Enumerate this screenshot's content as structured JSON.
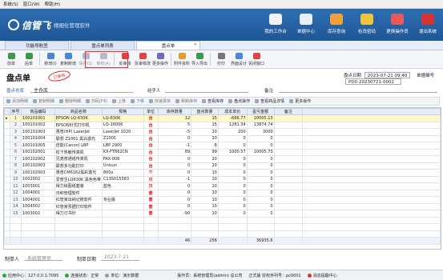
{
  "menubar": {
    "items": [
      "系统(S)",
      "窗口(W)",
      "帮助(H)"
    ]
  },
  "header": {
    "brand": "信管飞",
    "slogan": "精细化管理软件",
    "nav": [
      {
        "label": "我的工作台",
        "icon": "workbench-icon",
        "color": "#f3f3f3"
      },
      {
        "label": "单据中心",
        "icon": "document-center-icon",
        "color": "#e9eef9"
      },
      {
        "label": "库存查询",
        "icon": "inventory-icon",
        "color": "#f2a13a"
      },
      {
        "label": "检改密码",
        "icon": "password-lock-icon",
        "color": "#f1c43b"
      },
      {
        "label": "更换操作员",
        "icon": "switch-user-icon",
        "color": "#e85a5a"
      },
      {
        "label": "退出系统",
        "icon": "exit-icon",
        "color": "#d63333"
      }
    ]
  },
  "tabs": [
    "功能导航签",
    "盘点单列表",
    "盘点单"
  ],
  "toolbar": [
    {
      "label": "前单",
      "icon": "prev-icon",
      "color": "#3b9a4a",
      "enabled": true
    },
    {
      "label": "后单",
      "icon": "next-icon",
      "color": "#3b9a4a",
      "enabled": true
    },
    {
      "label": "新增(I)",
      "icon": "new-icon",
      "color": "#4a86d6",
      "enabled": true
    },
    {
      "label": "复制新增",
      "icon": "copy-icon",
      "color": "#4a86d6",
      "enabled": true
    },
    {
      "label": "保存(S)",
      "icon": "save-icon",
      "color": "#6d7fa0",
      "enabled": false
    },
    {
      "label": "审核(A)",
      "icon": "audit-icon",
      "color": "#6d7fa0",
      "enabled": false
    },
    {
      "label": "反审核",
      "icon": "unaudit-icon",
      "color": "#d44",
      "enabled": true
    },
    {
      "label": "反审核改",
      "icon": "unaudit-edit-icon",
      "color": "#d44",
      "enabled": true
    },
    {
      "label": "更多操作",
      "icon": "more-icon",
      "color": "#6d6db5",
      "enabled": true
    },
    {
      "label": "附件资料",
      "icon": "attachment-icon",
      "color": "#e39b2d",
      "enabled": true
    },
    {
      "label": "导入导出",
      "icon": "import-export-icon",
      "color": "#3b9a4a",
      "enabled": true
    },
    {
      "label": "打印",
      "icon": "print-icon",
      "color": "#777",
      "enabled": true
    },
    {
      "label": "界面设计",
      "icon": "design-icon",
      "color": "#4a86d6",
      "enabled": true
    },
    {
      "label": "关闭窗口",
      "icon": "close-window-icon",
      "color": "#d44",
      "enabled": true
    }
  ],
  "form": {
    "title": "盘点单",
    "stamp": "已审核",
    "date_label": "盘点日期",
    "date_value": "2023-07-21 09:40",
    "no_label": "单据编号",
    "no_value": "PD0-20230721-0002",
    "warehouse_label": "盘点仓库",
    "warehouse_value": "主仓库",
    "handler_label": "经手人",
    "handler_value": "",
    "remark_label": "备注",
    "remark_value": ""
  },
  "subtoolbar": [
    {
      "label": "添加明细",
      "on": false
    },
    {
      "label": "复制明细",
      "on": false
    },
    {
      "label": "删除明细",
      "on": false
    },
    {
      "label": "扫码(F4)",
      "on": false
    },
    {
      "label": "上移",
      "on": false
    },
    {
      "label": "下移",
      "on": false
    },
    {
      "label": "快速录单",
      "on": false
    },
    {
      "label": "刷新库存",
      "on": false
    },
    {
      "label": "查看库存",
      "on": true
    },
    {
      "label": "盘点操作",
      "on": true
    },
    {
      "label": "查看商品详情",
      "on": true
    },
    {
      "label": "更多操作",
      "on": true
    }
  ],
  "grid": {
    "columns": [
      "序号",
      "商品编码",
      "商品名称",
      "规格",
      "单位",
      "库存数量",
      "盘点数量",
      "成本单价",
      "盈亏金额",
      "备注"
    ],
    "rows": [
      [
        "1",
        "100101001",
        "EPSON LQ-630K",
        "LQ-630K",
        "台",
        "12",
        "15",
        "-666.77",
        "10005.13",
        ""
      ],
      [
        "2",
        "100101002",
        "EPSON针式打印机",
        "LQ-1600K",
        "台",
        "5",
        "15",
        "1281.34",
        "13874.74",
        ""
      ],
      [
        "3",
        "100101003",
        "惠普(HP) LaserJet",
        "LaserJet 1020",
        "台",
        "-5",
        "10",
        "200",
        "3000",
        ""
      ],
      [
        "4",
        "100101004",
        "联想 Z1001 黑白激光",
        "Z1001",
        "台",
        "0",
        "10",
        "0",
        "0",
        ""
      ],
      [
        "5",
        "100101005",
        "佳能(Canon) LBP",
        "LBP 2900",
        "台",
        "-1",
        "8",
        "0",
        "0",
        ""
      ],
      [
        "6",
        "100102001",
        "松下热敏传真机",
        "KX-FT862CN",
        "台",
        "89",
        "99",
        "1000.57",
        "10005.73",
        ""
      ],
      [
        "7",
        "100102002",
        "兄弟普通纸传真机",
        "FAX-008",
        "台",
        "0",
        "10",
        "0",
        "0",
        ""
      ],
      [
        "8",
        "100102003",
        "联想多功能打印",
        "Unisun",
        "台",
        "0",
        "10",
        "0",
        "0",
        ""
      ],
      [
        "9",
        "100102003",
        "惠普CM6162黑彩激光",
        "800x",
        "个",
        "0",
        "10",
        "0",
        "0",
        ""
      ],
      [
        "10",
        "1002002",
        "爱普生LQ630K 黑色色带",
        "C13S015583",
        "只",
        "-1",
        "10",
        "0",
        "0",
        ""
      ],
      [
        "11",
        "1003001",
        "得力绘图纸套装",
        "蓝色",
        "只",
        "0",
        "10",
        "0",
        "0",
        ""
      ],
      [
        "12",
        "1004001",
        "日积管理软件",
        "",
        "套",
        "0",
        "10",
        "0",
        "0",
        ""
      ],
      [
        "13",
        "1004001",
        "红管家出纳记账软件",
        "专业版",
        "套",
        "0",
        "10",
        "0",
        "0",
        ""
      ],
      [
        "14",
        "1004002",
        "红管家票据打印软件",
        "",
        "套",
        "0",
        "10",
        "0",
        "0",
        ""
      ],
      [
        "15",
        "1003002",
        "得力订书针",
        "",
        "套",
        "-90",
        "10",
        "0",
        "0",
        ""
      ]
    ],
    "total": {
      "qty": "46",
      "count": "256",
      "amount": "36935.6"
    }
  },
  "bottom": {
    "maker_label": "制单人",
    "maker_value": "系统管理员",
    "make_date_label": "制单日期",
    "make_date_value": "2023-7-21"
  },
  "status": [
    {
      "text": "应用中心：127.0.0.1:7095",
      "color": "#2aa63a"
    },
    {
      "text": "连接状态：正常",
      "color": "#2aa63a"
    },
    {
      "text": "单位：演示数据",
      "color": "#999"
    },
    {
      "text": "操作员：系统管理员(admin) 总公司",
      "color": ""
    },
    {
      "text": "正式版 授权序列号：pc0001",
      "color": ""
    },
    {
      "text": "消息提醒中心",
      "color": "#d33"
    }
  ]
}
